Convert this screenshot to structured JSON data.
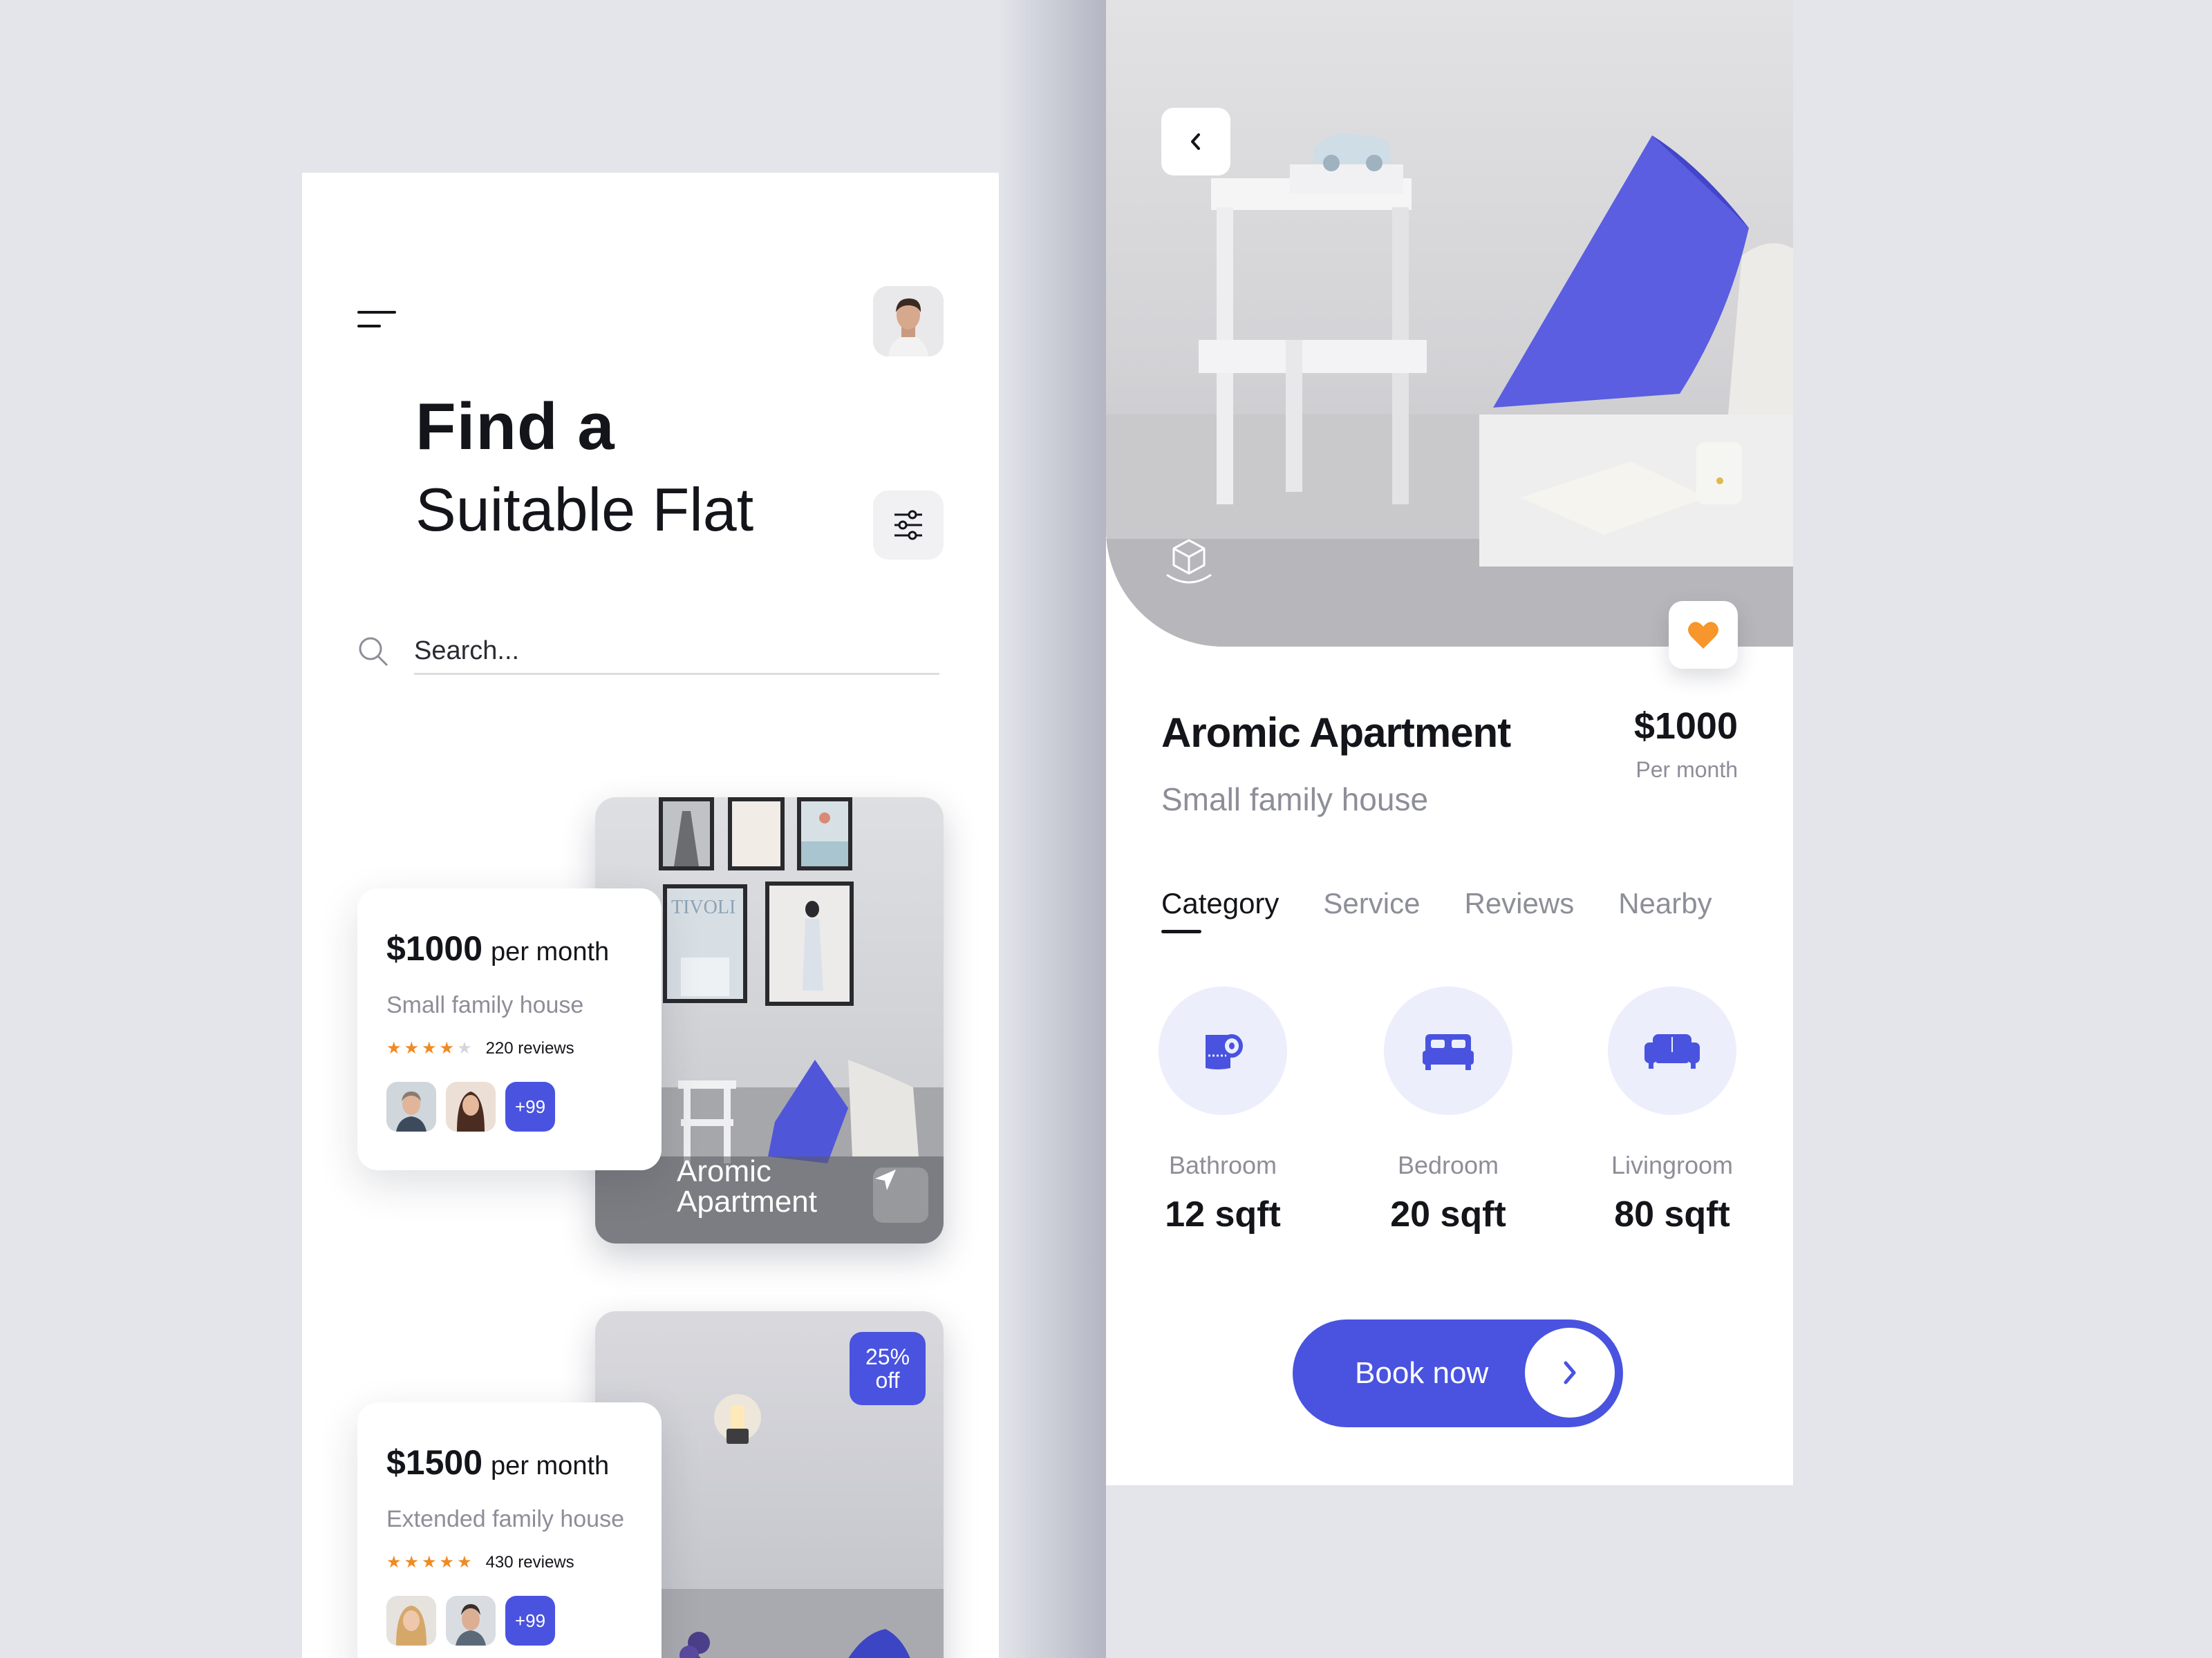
{
  "list_screen": {
    "heading_bold": "Find a",
    "heading_light": "Suitable Flat",
    "search": {
      "placeholder": "Search..."
    },
    "listings": [
      {
        "price": "$1000",
        "period": "per month",
        "subtitle": "Small family house",
        "rating": 4,
        "rating_max": 5,
        "reviews": "220 reviews",
        "extra_people": "+99",
        "photo_title": "Aromic\nApartment",
        "photo_poster_text": "TIVOLI"
      },
      {
        "price": "$1500",
        "period": "per month",
        "subtitle": "Extended family house",
        "rating": 5,
        "rating_max": 5,
        "reviews": "430 reviews",
        "extra_people": "+99",
        "discount": "25%\noff"
      }
    ]
  },
  "detail_screen": {
    "title": "Aromic Apartment",
    "subtitle": "Small family house",
    "price": "$1000",
    "price_period": "Per month",
    "tabs": [
      "Category",
      "Service",
      "Reviews",
      "Nearby"
    ],
    "active_tab": "Category",
    "categories": [
      {
        "label": "Bathroom",
        "area": "12 sqft",
        "icon": "toilet-paper-icon"
      },
      {
        "label": "Bedroom",
        "area": "20 sqft",
        "icon": "bed-icon"
      },
      {
        "label": "Livingroom",
        "area": "80 sqft",
        "icon": "sofa-icon"
      }
    ],
    "book_button": "Book now"
  },
  "colors": {
    "background": "#e3e5ea",
    "accent": "#4953e0",
    "accent_light": "#eceefb",
    "star": "#f08a24",
    "heart": "#f7962a",
    "text": "#14151a",
    "muted": "#8d8e98"
  }
}
